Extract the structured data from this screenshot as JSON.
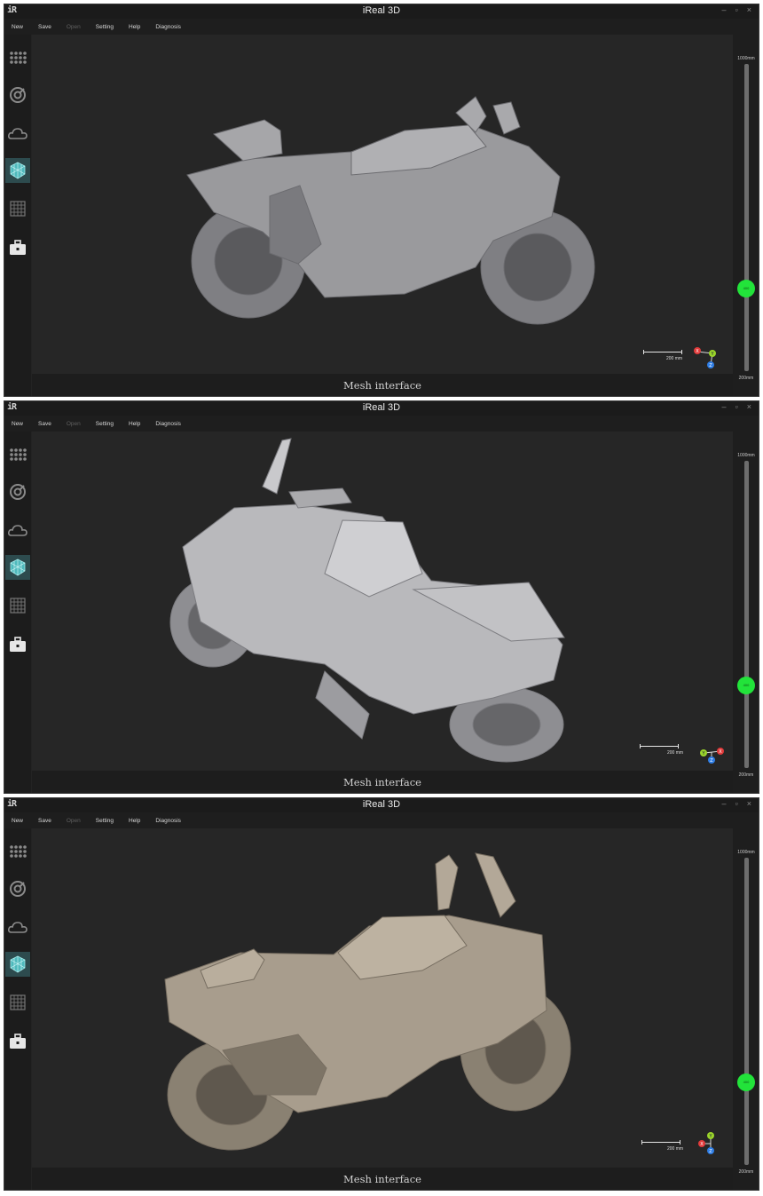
{
  "panels": [
    {
      "app": {
        "logo": "iR",
        "title": "iReal 3D"
      },
      "window_controls": {
        "minimize": "–",
        "maximize": "▫",
        "close": "×"
      },
      "menu": [
        {
          "label": "New",
          "enabled": true
        },
        {
          "label": "Save",
          "enabled": true
        },
        {
          "label": "Open",
          "enabled": false
        },
        {
          "label": "Setting",
          "enabled": true
        },
        {
          "label": "Help",
          "enabled": true
        },
        {
          "label": "Diagnosis",
          "enabled": true
        }
      ],
      "tools": [
        "dots-grid-icon",
        "scan-target-icon",
        "point-cloud-icon",
        "mesh-cube-icon",
        "grid-icon",
        "toolbox-icon"
      ],
      "active_tool": "mesh-cube-icon",
      "slider": {
        "top_label": "1000mm",
        "bottom_label": "200mm",
        "thumb_label": "400",
        "level": 0.27
      },
      "scale": {
        "label": "200 mm"
      },
      "axes": [
        "X",
        "Y",
        "Z"
      ],
      "status": "Mesh interface",
      "model_color": "#9a9a9d"
    },
    {
      "app": {
        "logo": "iR",
        "title": "iReal 3D"
      },
      "window_controls": {
        "minimize": "–",
        "maximize": "▫",
        "close": "×"
      },
      "menu": [
        {
          "label": "New",
          "enabled": true
        },
        {
          "label": "Save",
          "enabled": true
        },
        {
          "label": "Open",
          "enabled": false
        },
        {
          "label": "Setting",
          "enabled": true
        },
        {
          "label": "Help",
          "enabled": true
        },
        {
          "label": "Diagnosis",
          "enabled": true
        }
      ],
      "tools": [
        "dots-grid-icon",
        "scan-target-icon",
        "point-cloud-icon",
        "mesh-cube-icon",
        "grid-icon",
        "toolbox-icon"
      ],
      "active_tool": "mesh-cube-icon",
      "slider": {
        "top_label": "1000mm",
        "bottom_label": "200mm",
        "thumb_label": "400",
        "level": 0.27
      },
      "scale": {
        "label": "200 mm"
      },
      "axes": [
        "Y",
        "Z",
        "X"
      ],
      "status": "Mesh interface",
      "model_color": "#b9b9bc"
    },
    {
      "app": {
        "logo": "iR",
        "title": "iReal 3D"
      },
      "window_controls": {
        "minimize": "–",
        "maximize": "▫",
        "close": "×"
      },
      "menu": [
        {
          "label": "New",
          "enabled": true
        },
        {
          "label": "Save",
          "enabled": true
        },
        {
          "label": "Open",
          "enabled": false
        },
        {
          "label": "Setting",
          "enabled": true
        },
        {
          "label": "Help",
          "enabled": true
        },
        {
          "label": "Diagnosis",
          "enabled": true
        }
      ],
      "tools": [
        "dots-grid-icon",
        "scan-target-icon",
        "point-cloud-icon",
        "mesh-cube-icon",
        "grid-icon",
        "toolbox-icon"
      ],
      "active_tool": "mesh-cube-icon",
      "slider": {
        "top_label": "1000mm",
        "bottom_label": "200mm",
        "thumb_label": "400",
        "level": 0.27
      },
      "scale": {
        "label": "200 mm"
      },
      "axes": [
        "X",
        "Y",
        "Z"
      ],
      "status": "Mesh interface",
      "model_color": "#a89d8d"
    }
  ],
  "colors": {
    "axis_x": "#e23b3b",
    "axis_y": "#9bd52b",
    "axis_z": "#2f7ee6",
    "active_tool_bg": "#2d4b4e"
  }
}
